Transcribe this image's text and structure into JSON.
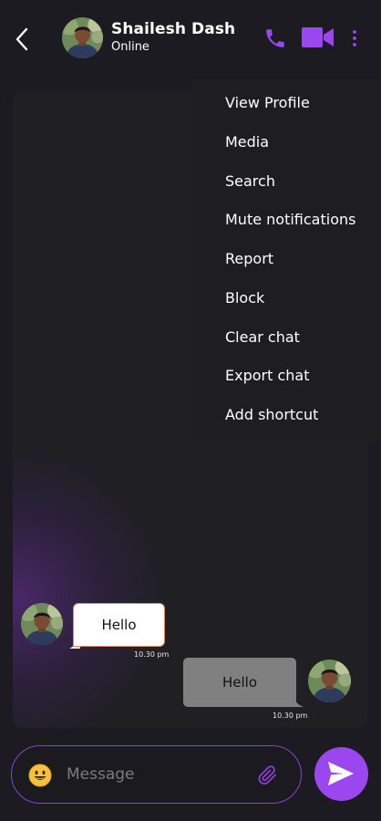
{
  "header": {
    "contact_name": "Shailesh Dash",
    "status": "Online",
    "icons": {
      "back": "chevron-left-icon",
      "call": "phone-icon",
      "video": "video-camera-icon",
      "more": "more-vertical-icon"
    },
    "accent_color": "#9a47f0"
  },
  "menu": {
    "items": [
      {
        "label": "View Profile"
      },
      {
        "label": "Media"
      },
      {
        "label": "Search"
      },
      {
        "label": "Mute notifications"
      },
      {
        "label": "Report"
      },
      {
        "label": "Block"
      },
      {
        "label": "Clear chat"
      },
      {
        "label": "Export chat"
      },
      {
        "label": "Add shortcut"
      }
    ]
  },
  "messages": [
    {
      "direction": "incoming",
      "text": "Hello",
      "time": "10.30 pm"
    },
    {
      "direction": "outgoing",
      "text": "Hello",
      "time": "10.30 pm"
    }
  ],
  "composer": {
    "placeholder": "Message",
    "value": "",
    "icons": {
      "emoji": "emoji-icon",
      "attach": "paperclip-icon",
      "send": "send-icon"
    }
  },
  "colors": {
    "background": "#1b1b21",
    "chat_panel": "#1f1f24",
    "incoming_bubble": "#ffffff",
    "outgoing_bubble": "#808080",
    "composer_border": "#8b3fd9",
    "send_button": "#9a47f0"
  }
}
